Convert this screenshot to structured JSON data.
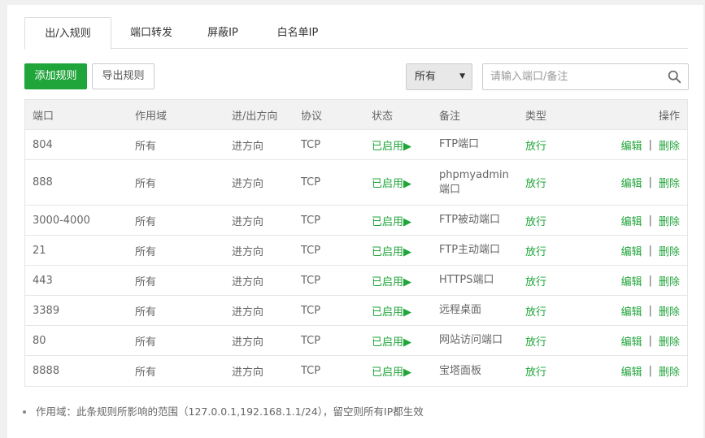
{
  "tabs": [
    {
      "label": "出/入规则",
      "active": true
    },
    {
      "label": "端口转发"
    },
    {
      "label": "屏蔽IP"
    },
    {
      "label": "白名单IP"
    }
  ],
  "toolbar": {
    "add_label": "添加规则",
    "export_label": "导出规则",
    "filter_value": "所有",
    "search_placeholder": "请输入端口/备注"
  },
  "table": {
    "headers": {
      "port": "端口",
      "scope": "作用域",
      "direction": "进/出方向",
      "protocol": "协议",
      "status": "状态",
      "note": "备注",
      "type": "类型",
      "ops": "操作"
    },
    "rows": [
      {
        "port": "804",
        "scope": "所有",
        "direction": "进方向",
        "protocol": "TCP",
        "status": "已启用▶",
        "note": "FTP端口",
        "type": "放行",
        "edit": "编辑",
        "sep": "|",
        "del": "删除"
      },
      {
        "port": "888",
        "scope": "所有",
        "direction": "进方向",
        "protocol": "TCP",
        "status": "已启用▶",
        "note": "phpmyadmin端口",
        "type": "放行",
        "edit": "编辑",
        "sep": "|",
        "del": "删除"
      },
      {
        "port": "3000-4000",
        "scope": "所有",
        "direction": "进方向",
        "protocol": "TCP",
        "status": "已启用▶",
        "note": "FTP被动端口",
        "type": "放行",
        "edit": "编辑",
        "sep": "|",
        "del": "删除"
      },
      {
        "port": "21",
        "scope": "所有",
        "direction": "进方向",
        "protocol": "TCP",
        "status": "已启用▶",
        "note": "FTP主动端口",
        "type": "放行",
        "edit": "编辑",
        "sep": "|",
        "del": "删除"
      },
      {
        "port": "443",
        "scope": "所有",
        "direction": "进方向",
        "protocol": "TCP",
        "status": "已启用▶",
        "note": "HTTPS端口",
        "type": "放行",
        "edit": "编辑",
        "sep": "|",
        "del": "删除"
      },
      {
        "port": "3389",
        "scope": "所有",
        "direction": "进方向",
        "protocol": "TCP",
        "status": "已启用▶",
        "note": "远程桌面",
        "type": "放行",
        "edit": "编辑",
        "sep": "|",
        "del": "删除"
      },
      {
        "port": "80",
        "scope": "所有",
        "direction": "进方向",
        "protocol": "TCP",
        "status": "已启用▶",
        "note": "网站访问端口",
        "type": "放行",
        "edit": "编辑",
        "sep": "|",
        "del": "删除"
      },
      {
        "port": "8888",
        "scope": "所有",
        "direction": "进方向",
        "protocol": "TCP",
        "status": "已启用▶",
        "note": "宝塔面板",
        "type": "放行",
        "edit": "编辑",
        "sep": "|",
        "del": "删除"
      }
    ]
  },
  "footer_note": "作用域：此条规则所影响的范围（127.0.0.1,192.168.1.1/24），留空则所有IP都生效",
  "colors": {
    "accent": "#20a53a",
    "header_bg": "#f2f2f2",
    "page_bg": "#f0f0f0"
  }
}
